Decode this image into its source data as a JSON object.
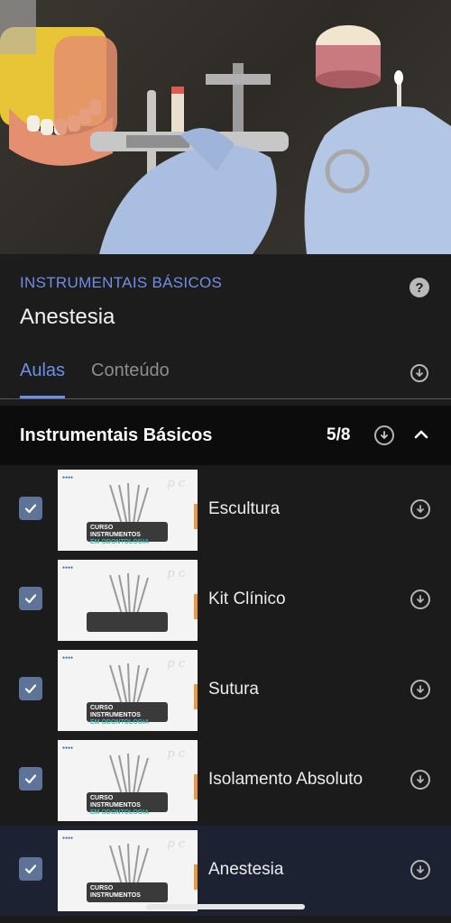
{
  "course": {
    "category": "INSTRUMENTAIS BÁSICOS",
    "title": "Anestesia"
  },
  "tabs": [
    {
      "label": "Aulas",
      "active": true
    },
    {
      "label": "Conteúdo",
      "active": false
    }
  ],
  "module": {
    "title": "Instrumentais Básicos",
    "progress": "5/8",
    "expanded": true
  },
  "lessons": [
    {
      "label": "Escultura",
      "completed": true,
      "thumb_line1": "CURSO INSTRUMENTOS",
      "thumb_line2": "EM ODONTOLOGIA"
    },
    {
      "label": "Kit Clínico",
      "completed": true,
      "thumb_line1": "",
      "thumb_line2": ""
    },
    {
      "label": "Sutura",
      "completed": true,
      "thumb_line1": "CURSO INSTRUMENTOS",
      "thumb_line2": "EM ODONTOLOGIA"
    },
    {
      "label": "Isolamento Absoluto",
      "completed": true,
      "thumb_line1": "CURSO INSTRUMENTOS",
      "thumb_line2": "EM ODONTOLOGIA"
    },
    {
      "label": "Anestesia",
      "completed": true,
      "current": true,
      "thumb_line1": "CURSO INSTRUMENTOS",
      "thumb_line2": ""
    }
  ],
  "icons": {
    "help": "question-circle-icon",
    "download": "download-circle-icon",
    "collapse": "chevron-up-icon",
    "check": "checkmark-icon"
  },
  "colors": {
    "accent": "#6f8fe6",
    "checkbox": "#5d7398",
    "background": "#1b1b1b",
    "section_bg": "#0c0c0c",
    "current_row": "#1d2233"
  }
}
